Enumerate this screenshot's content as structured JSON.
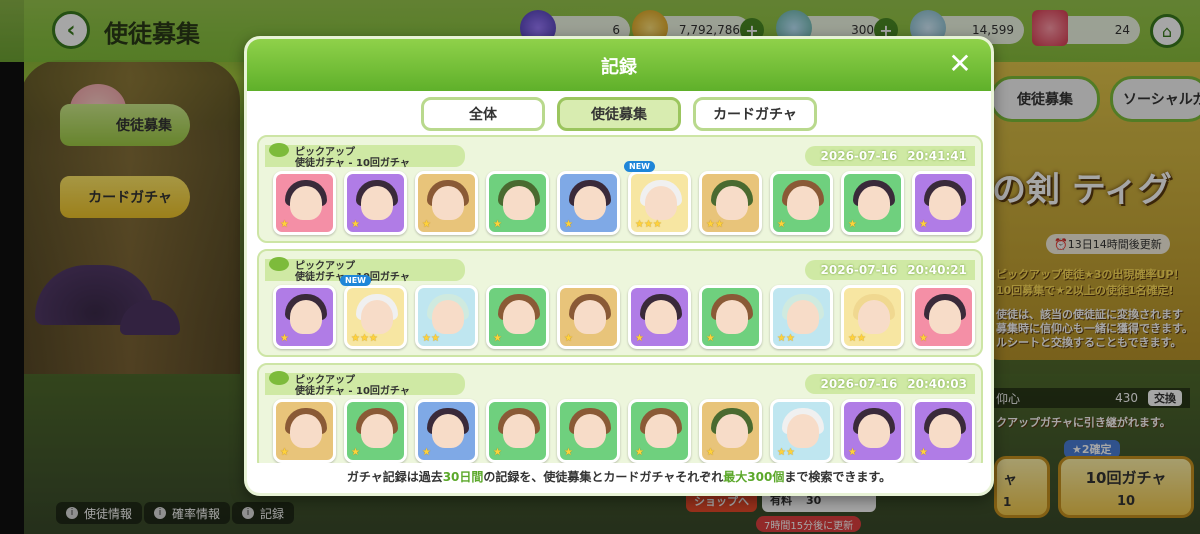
{
  "screen": {
    "title": "使徒募集"
  },
  "resources": [
    {
      "icon": "crystal-icon",
      "value": "6"
    },
    {
      "icon": "coin-icon",
      "value": "7,792,786"
    },
    {
      "icon": "leaf-icon",
      "value": "300"
    },
    {
      "icon": "leaf-gem-icon",
      "value": "14,599"
    },
    {
      "icon": "ticket-icon",
      "value": "24"
    }
  ],
  "side_tabs": [
    {
      "label": "使徒募集",
      "active": true
    },
    {
      "label": "カードガチャ",
      "active": false
    }
  ],
  "bottom_info": [
    {
      "label": "使徒情報"
    },
    {
      "label": "確率情報"
    },
    {
      "label": "記録"
    }
  ],
  "background_right": {
    "tabs": [
      "使徒募集",
      "ソーシャルガ"
    ],
    "banner_title": "の剣 ティグ",
    "timer": "13日14時間後更新",
    "notes": [
      "ピックアップ使徒★3の出現確率UP！",
      "10回募集で★2以上の使徒1名確定!",
      "使徒は、該当の使徒証に変換されます",
      "募集時に信仰心も一緒に獲得できます。",
      "ルシートと交換することもできます。"
    ],
    "faith_label": "仰心",
    "faith_value": "430",
    "exchange_label": "交換",
    "carryover": "クアップガチャに引き継がれます。",
    "single_gacha_label": "ャ",
    "single_gacha_count": "1",
    "ten_gacha_label": "10回ガチャ",
    "ten_gacha_count": "10",
    "guarantee_badge": "2確定",
    "shop_label": "ショップへ",
    "paid_label": "有料",
    "paid_value": "30",
    "refresh": "7時間15分後に更新"
  },
  "modal": {
    "title": "記録",
    "tabs": [
      {
        "label": "全体",
        "active": false
      },
      {
        "label": "使徒募集",
        "active": true
      },
      {
        "label": "カードガチャ",
        "active": false
      }
    ],
    "records": [
      {
        "pickup": "ピックアップ",
        "name": "使徒ガチャ - 10回ガチャ",
        "date": "2026-07-16",
        "time": "20:41:41",
        "cards": [
          {
            "bg": "pink",
            "hair": "dark",
            "stars": "★",
            "new": false
          },
          {
            "bg": "purple",
            "hair": "dark",
            "stars": "★",
            "new": false
          },
          {
            "bg": "brown",
            "hair": "brownh",
            "stars": "★",
            "new": false
          },
          {
            "bg": "green",
            "hair": "greenh",
            "stars": "★",
            "new": false
          },
          {
            "bg": "blue",
            "hair": "dark",
            "stars": "★",
            "new": false
          },
          {
            "bg": "gold",
            "hair": "white",
            "stars": "★★★",
            "new": true,
            "new_label": "NEW"
          },
          {
            "bg": "brown",
            "hair": "greenh",
            "stars": "★★",
            "new": false
          },
          {
            "bg": "green",
            "hair": "brownh",
            "stars": "★",
            "new": false
          },
          {
            "bg": "green",
            "hair": "dark",
            "stars": "★",
            "new": false
          },
          {
            "bg": "purple",
            "hair": "dark",
            "stars": "★",
            "new": false
          }
        ]
      },
      {
        "pickup": "ピックアップ",
        "name": "使徒ガチャ - 10回ガチャ",
        "date": "2026-07-16",
        "time": "20:40:21",
        "cards": [
          {
            "bg": "purple",
            "hair": "dark",
            "stars": "★",
            "new": false
          },
          {
            "bg": "gold",
            "hair": "white",
            "stars": "★★★",
            "new": true,
            "new_label": "NEW"
          },
          {
            "bg": "pale",
            "hair": "mint",
            "stars": "★★",
            "new": false
          },
          {
            "bg": "green",
            "hair": "brownh",
            "stars": "★",
            "new": false
          },
          {
            "bg": "brown",
            "hair": "brownh",
            "stars": "★",
            "new": false
          },
          {
            "bg": "purple",
            "hair": "dark",
            "stars": "★",
            "new": false
          },
          {
            "bg": "green",
            "hair": "brownh",
            "stars": "★",
            "new": false
          },
          {
            "bg": "pale",
            "hair": "mint",
            "stars": "★★",
            "new": false
          },
          {
            "bg": "gold",
            "hair": "blond",
            "stars": "★★",
            "new": false
          },
          {
            "bg": "pink",
            "hair": "dark",
            "stars": "★",
            "new": false
          }
        ]
      },
      {
        "pickup": "ピックアップ",
        "name": "使徒ガチャ - 10回ガチャ",
        "date": "2026-07-16",
        "time": "20:40:03",
        "cards": [
          {
            "bg": "brown",
            "hair": "brownh",
            "stars": "★",
            "new": false
          },
          {
            "bg": "green",
            "hair": "brownh",
            "stars": "★",
            "new": false
          },
          {
            "bg": "blue",
            "hair": "dark",
            "stars": "★",
            "new": false
          },
          {
            "bg": "green",
            "hair": "brownh",
            "stars": "★",
            "new": false
          },
          {
            "bg": "green",
            "hair": "brownh",
            "stars": "★",
            "new": false
          },
          {
            "bg": "green",
            "hair": "brownh",
            "stars": "★",
            "new": false
          },
          {
            "bg": "brown",
            "hair": "greenh",
            "stars": "★",
            "new": false
          },
          {
            "bg": "pale",
            "hair": "white",
            "stars": "★★",
            "new": false
          },
          {
            "bg": "purple",
            "hair": "dark",
            "stars": "★",
            "new": false
          },
          {
            "bg": "purple",
            "hair": "dark",
            "stars": "★",
            "new": false
          }
        ]
      }
    ],
    "footer": {
      "part1": "ガチャ記録は過去",
      "days": "30日間",
      "part2": "の記録を、使徒募集とカードガチャそれぞれ",
      "max": "最大300個",
      "part3": "まで検索できます。"
    }
  },
  "colors": {
    "accent_green": "#5fb02a",
    "new_blue": "#1f86d8"
  }
}
